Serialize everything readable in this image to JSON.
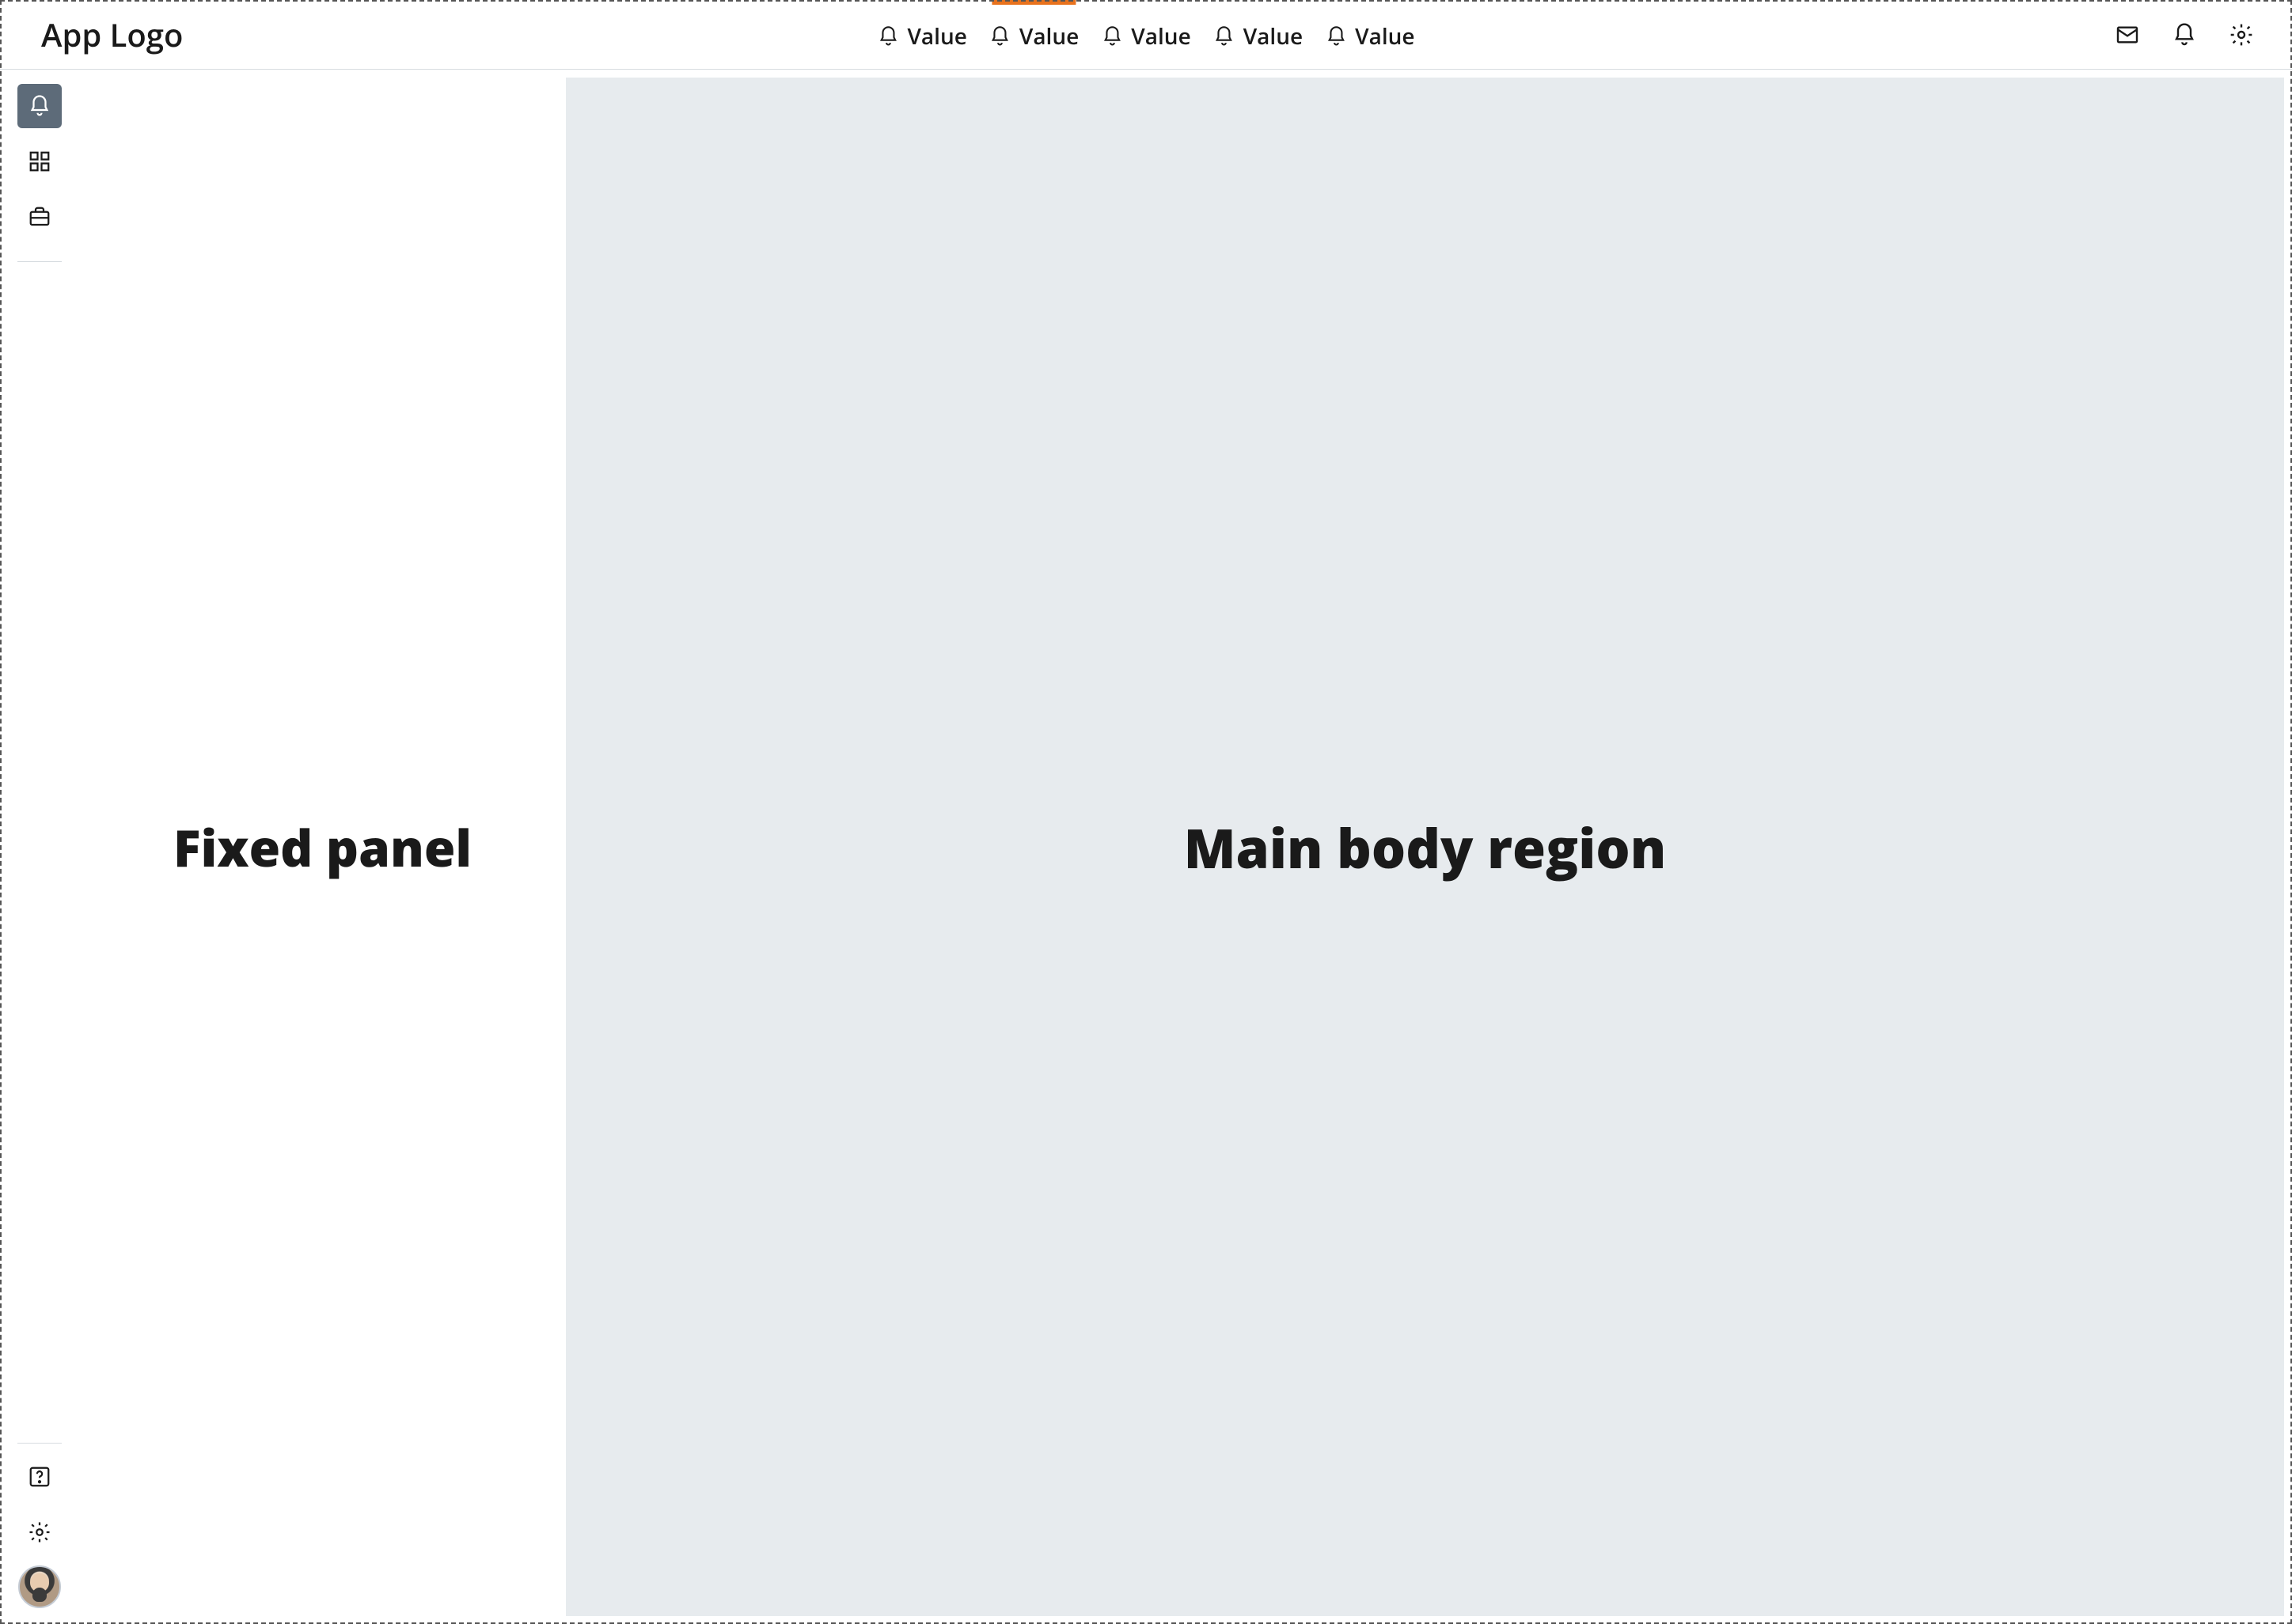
{
  "header": {
    "logo": "App Logo",
    "nav_items": [
      {
        "label": "Value",
        "active": false
      },
      {
        "label": "Value",
        "active": true
      },
      {
        "label": "Value",
        "active": false
      },
      {
        "label": "Value",
        "active": false
      },
      {
        "label": "Value",
        "active": false
      }
    ],
    "right_icons": [
      "mail-icon",
      "bell-icon",
      "settings-gear-icon"
    ]
  },
  "sidebar": {
    "top_items": [
      {
        "icon": "bell-icon",
        "selected": true
      },
      {
        "icon": "grid-icon",
        "selected": false
      },
      {
        "icon": "briefcase-icon",
        "selected": false
      }
    ],
    "bottom_items": [
      {
        "icon": "help-icon"
      },
      {
        "icon": "settings-gear-icon"
      }
    ],
    "avatar": "user-avatar"
  },
  "panel": {
    "title": "Fixed panel"
  },
  "main": {
    "title": "Main body region"
  }
}
